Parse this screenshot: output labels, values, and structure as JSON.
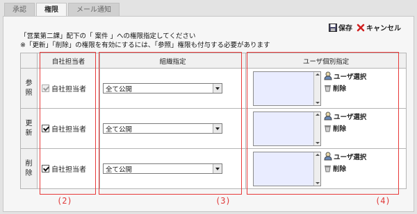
{
  "tabs": [
    {
      "label": "承認",
      "active": false
    },
    {
      "label": "権限",
      "active": true
    },
    {
      "label": "メール通知",
      "active": false
    }
  ],
  "actions": {
    "save": "保存",
    "cancel": "キャンセル"
  },
  "instructions": {
    "line1": "「営業第二課」配下の「 案件 」への権限指定してください",
    "line2": "※「更新」「削除」の権限を有効にするには、「参照」権限も付与する必要があります"
  },
  "table": {
    "headers": {
      "col2": "自社担当者",
      "col3": "組織指定",
      "col4": "ユーザ個別指定"
    },
    "rows": [
      {
        "label_top": "参",
        "label_bottom": "照",
        "checkbox": "自社担当者",
        "checked": true,
        "disabled": true,
        "org": "全て公開",
        "user_select": "ユーザ選択",
        "delete": "削除"
      },
      {
        "label_top": "更",
        "label_bottom": "新",
        "checkbox": "自社担当者",
        "checked": true,
        "disabled": false,
        "org": "全て公開",
        "user_select": "ユーザ選択",
        "delete": "削除"
      },
      {
        "label_top": "削",
        "label_bottom": "除",
        "checkbox": "自社担当者",
        "checked": true,
        "disabled": false,
        "org": "全て公開",
        "user_select": "ユーザ選択",
        "delete": "削除"
      }
    ]
  },
  "annotations": {
    "n2": "(2)",
    "n3": "(3)",
    "n4": "(4)"
  },
  "colors": {
    "annotation_red": "#e83838",
    "list_bg": "#e9ecff"
  }
}
